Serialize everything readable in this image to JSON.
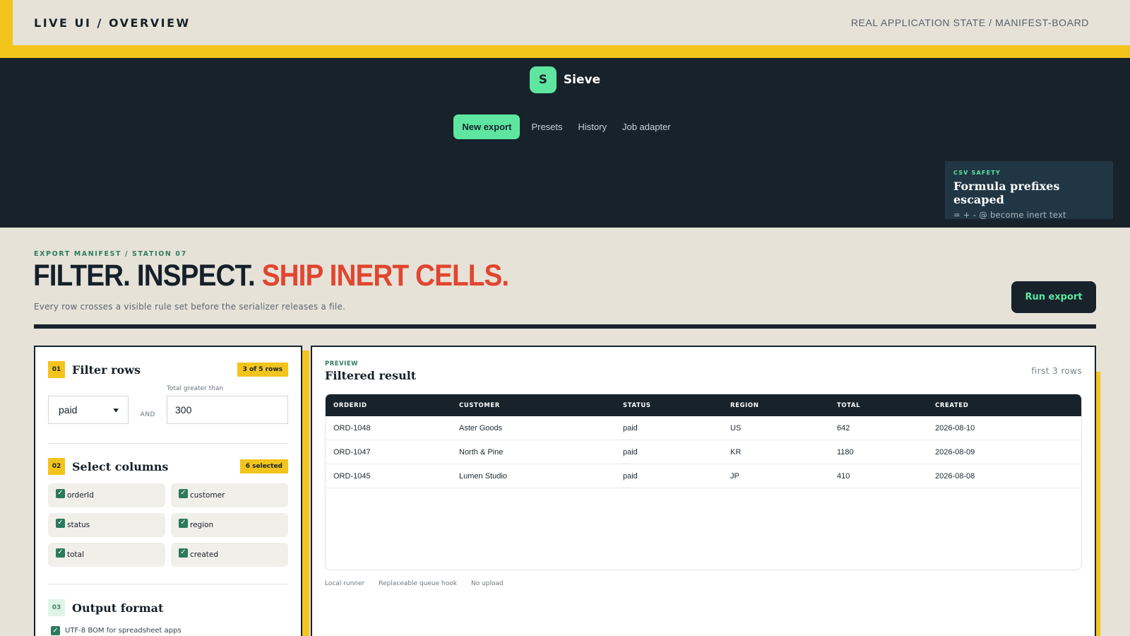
{
  "topbar": {
    "title": "LIVE UI / OVERVIEW",
    "context": "REAL APPLICATION STATE / MANIFEST-BOARD"
  },
  "app": {
    "logo_letter": "S",
    "name": "Sieve",
    "nav": [
      {
        "label": "New export",
        "active": true
      },
      {
        "label": "Presets",
        "active": false
      },
      {
        "label": "History",
        "active": false
      },
      {
        "label": "Job adapter",
        "active": false
      }
    ],
    "safety": {
      "kicker": "CSV SAFETY",
      "title": "Formula prefixes escaped",
      "subtitle": "= + - @ become inert text"
    }
  },
  "hero": {
    "kicker": "EXPORT MANIFEST / STATION 07",
    "title_dark": "FILTER. INSPECT.",
    "title_accent": "SHIP INERT CELLS.",
    "subtitle": "Every row crosses a visible rule set before the serializer releases a file.",
    "run_label": "Run export"
  },
  "filter": {
    "num": "01",
    "title": "Filter rows",
    "badge": "3 of 5 rows",
    "status_value": "paid",
    "joiner": "AND",
    "total_label": "Total greater than",
    "total_value": "300"
  },
  "columns": {
    "num": "02",
    "title": "Select columns",
    "badge": "6 selected",
    "items": [
      {
        "label": "orderId",
        "checked": true
      },
      {
        "label": "customer",
        "checked": true
      },
      {
        "label": "status",
        "checked": true
      },
      {
        "label": "region",
        "checked": true
      },
      {
        "label": "total",
        "checked": true
      },
      {
        "label": "created",
        "checked": true
      }
    ]
  },
  "output": {
    "num": "03",
    "title": "Output format",
    "options": [
      {
        "label": "UTF-8 BOM for spreadsheet apps",
        "checked": true
      }
    ]
  },
  "preview": {
    "kicker": "PREVIEW",
    "title": "Filtered result",
    "meta": "first 3 rows",
    "headers": [
      "ORDERID",
      "CUSTOMER",
      "STATUS",
      "REGION",
      "TOTAL",
      "CREATED"
    ],
    "rows": [
      [
        "ORD-1048",
        "Aster Goods",
        "paid",
        "US",
        "642",
        "2026-08-10"
      ],
      [
        "ORD-1047",
        "North & Pine",
        "paid",
        "KR",
        "1180",
        "2026-08-09"
      ],
      [
        "ORD-1045",
        "Lumen Studio",
        "paid",
        "JP",
        "410",
        "2026-08-08"
      ]
    ],
    "footer": [
      "Local runner",
      "Replaceable queue hook",
      "No upload"
    ]
  },
  "colors": {
    "accent_yellow": "#f3c41c",
    "accent_green": "#5ee6a0",
    "dark": "#17222b",
    "alert_red": "#e2452f"
  }
}
